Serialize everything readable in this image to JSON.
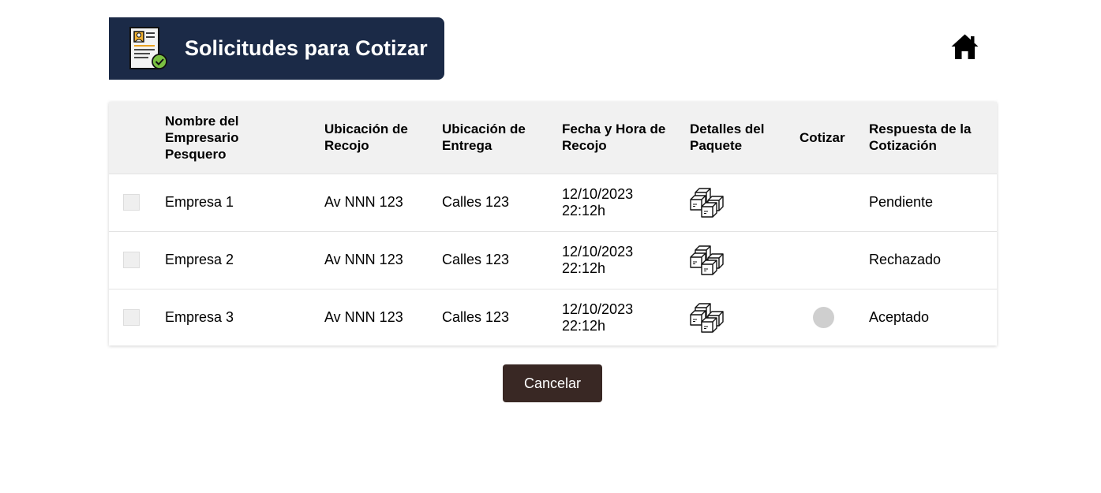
{
  "header": {
    "title": "Solicitudes para Cotizar",
    "icon": "quote-document-icon",
    "background_color": "#1b2a47"
  },
  "home": {
    "icon": "home-icon"
  },
  "table": {
    "columns": [
      "",
      "Nombre del Empresario Pesquero",
      "Ubicación de Recojo",
      "Ubicación de Entrega",
      "Fecha y Hora de Recojo",
      "Detalles del Paquete",
      "Cotizar",
      "Respuesta de la Cotización"
    ],
    "rows": [
      {
        "empresa": "Empresa 1",
        "recojo": "Av NNN 123",
        "entrega": "Calles 123",
        "fecha": "12/10/2023",
        "hora": "22:12h",
        "paquete_icon": "packages-icon",
        "cotizar": false,
        "respuesta": "Pendiente"
      },
      {
        "empresa": "Empresa 2",
        "recojo": "Av NNN 123",
        "entrega": "Calles 123",
        "fecha": "12/10/2023",
        "hora": "22:12h",
        "paquete_icon": "packages-icon",
        "cotizar": false,
        "respuesta": "Rechazado"
      },
      {
        "empresa": "Empresa 3",
        "recojo": "Av NNN 123",
        "entrega": "Calles 123",
        "fecha": "12/10/2023",
        "hora": "22:12h",
        "paquete_icon": "packages-icon",
        "cotizar": true,
        "respuesta": "Aceptado"
      }
    ]
  },
  "actions": {
    "cancel_label": "Cancelar",
    "cancel_color": "#392824"
  }
}
